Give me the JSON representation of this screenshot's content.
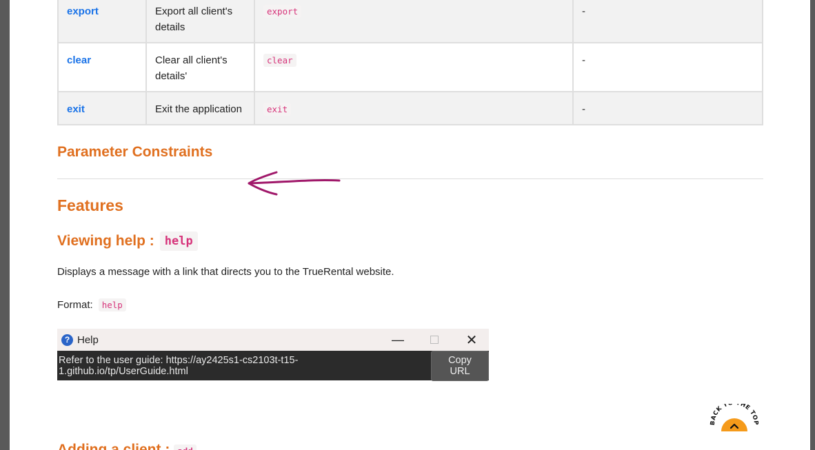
{
  "commands": [
    {
      "name": "export",
      "description": "Export all client's details",
      "format": "export",
      "example": "-"
    },
    {
      "name": "clear",
      "description": "Clear all client's details'",
      "format": "clear",
      "example": "-"
    },
    {
      "name": "exit",
      "description": "Exit the application",
      "format": "exit",
      "example": "-"
    }
  ],
  "headings": {
    "parameter_constraints": "Parameter Constraints",
    "features": "Features",
    "viewing_help": "Viewing help :",
    "viewing_help_code": "help",
    "adding_client": "Adding a client :",
    "adding_client_code": "add"
  },
  "paragraphs": {
    "description": "Displays a message with a link that directs you to the TrueRental website.",
    "format_label": "Format:",
    "format_code": "help"
  },
  "help_window": {
    "title": "Help",
    "message": "Refer to the user guide: https://ay2425s1-cs2103t-t15-1.github.io/tp/UserGuide.html",
    "button": "Copy URL",
    "minimize": "—",
    "close": "✕"
  },
  "back_to_top": "BACK TO THE TOP",
  "colors": {
    "heading": "#e07020",
    "link": "#1a73e8",
    "code": "#d6337a",
    "annotation": "#a0186a",
    "back_to_top": "#f59a1a"
  }
}
